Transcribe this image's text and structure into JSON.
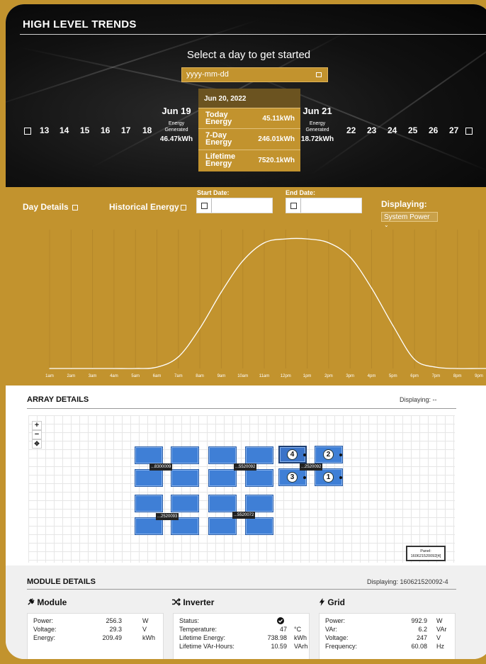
{
  "trends": {
    "title": "HIGH LEVEL TRENDS",
    "prompt": "Select a day to get started",
    "date_placeholder": "yyyy-mm-dd",
    "days_left": [
      "13",
      "14",
      "15",
      "16",
      "17",
      "18"
    ],
    "days_right": [
      "22",
      "23",
      "24",
      "25",
      "26",
      "27"
    ],
    "prev_day": {
      "date": "Jun 19",
      "label1": "Energy",
      "label2": "Generated",
      "value": "46.47kWh"
    },
    "next_day": {
      "date": "Jun 21",
      "label1": "Energy",
      "label2": "Generated",
      "value": "18.72kWh"
    },
    "popup": {
      "date": "Jun 20, 2022",
      "rows": [
        {
          "l1": "Today",
          "l2": "Energy",
          "value": "45.11kWh"
        },
        {
          "l1": "7-Day",
          "l2": "Energy",
          "value": "246.01kWh"
        },
        {
          "l1": "Lifetime",
          "l2": "Energy",
          "value": "7520.1kWh"
        }
      ]
    }
  },
  "controls": {
    "day_details": "Day Details",
    "historical_energy": "Historical Energy",
    "start_date": "Start Date:",
    "end_date": "End Date:",
    "displaying": "Displaying:",
    "displaying_value": "System Power",
    "select_arrow": "⌄"
  },
  "colors": {
    "accent": "#c2932e",
    "dark": "#111111",
    "panel": "#3f7fd6"
  },
  "chart_data": {
    "type": "line",
    "title": "",
    "xlabel": "",
    "ylabel": "",
    "x": [
      "1am",
      "2am",
      "3am",
      "4am",
      "5am",
      "6am",
      "7am",
      "8am",
      "9am",
      "10am",
      "11am",
      "12pm",
      "1pm",
      "2pm",
      "3pm",
      "4pm",
      "5pm",
      "6pm",
      "7pm",
      "8pm",
      "9pm",
      "10pm",
      "11pm"
    ],
    "series": [
      {
        "values": [
          0,
          0,
          0,
          0,
          0,
          0.01,
          0.09,
          0.31,
          0.59,
          0.83,
          0.97,
          1.0,
          1.0,
          0.97,
          0.86,
          0.62,
          0.33,
          0.07,
          0.01,
          0,
          0,
          0,
          0
        ]
      }
    ],
    "ylim": [
      0,
      1.05
    ],
    "grid": true
  },
  "array": {
    "title": "ARRAY DETAILS",
    "displaying": "Displaying: --",
    "zoom_in": "+",
    "zoom_out": "−",
    "reset": "✥",
    "tags": [
      "...8300009",
      "...5520092",
      "...2520092",
      "...2520093",
      "...5520072"
    ],
    "badges": [
      "4",
      "2",
      "3",
      "1"
    ],
    "panel_tag_1": "Panel:",
    "panel_tag_2": "160621520092[4]"
  },
  "module": {
    "title": "MODULE DETAILS",
    "displaying": "Displaying: 160621520092-4",
    "module": {
      "heading": "Module",
      "icon": "plug-icon",
      "rows": [
        {
          "k": "Power:",
          "v": "256.3",
          "u": "W"
        },
        {
          "k": "Voltage:",
          "v": "29.3",
          "u": "V"
        },
        {
          "k": "Energy:",
          "v": "209.49",
          "u": "kWh"
        }
      ]
    },
    "inverter": {
      "heading": "Inverter",
      "icon": "shuffle-icon",
      "rows": [
        {
          "k": "Status:",
          "v": "",
          "u": ""
        },
        {
          "k": "Temperature:",
          "v": "47",
          "u": "°C"
        },
        {
          "k": "Lifetime Energy:",
          "v": "738.98",
          "u": "kWh"
        },
        {
          "k": "Lifetime VAr-Hours:",
          "v": "10.59",
          "u": "VArh"
        }
      ]
    },
    "grid": {
      "heading": "Grid",
      "icon": "bolt-icon",
      "rows": [
        {
          "k": "Power:",
          "v": "992.9",
          "u": "W"
        },
        {
          "k": "VAr:",
          "v": "6.2",
          "u": "VAr"
        },
        {
          "k": "Voltage:",
          "v": "247",
          "u": "V"
        },
        {
          "k": "Frequency:",
          "v": "60.08",
          "u": "Hz"
        }
      ]
    }
  }
}
